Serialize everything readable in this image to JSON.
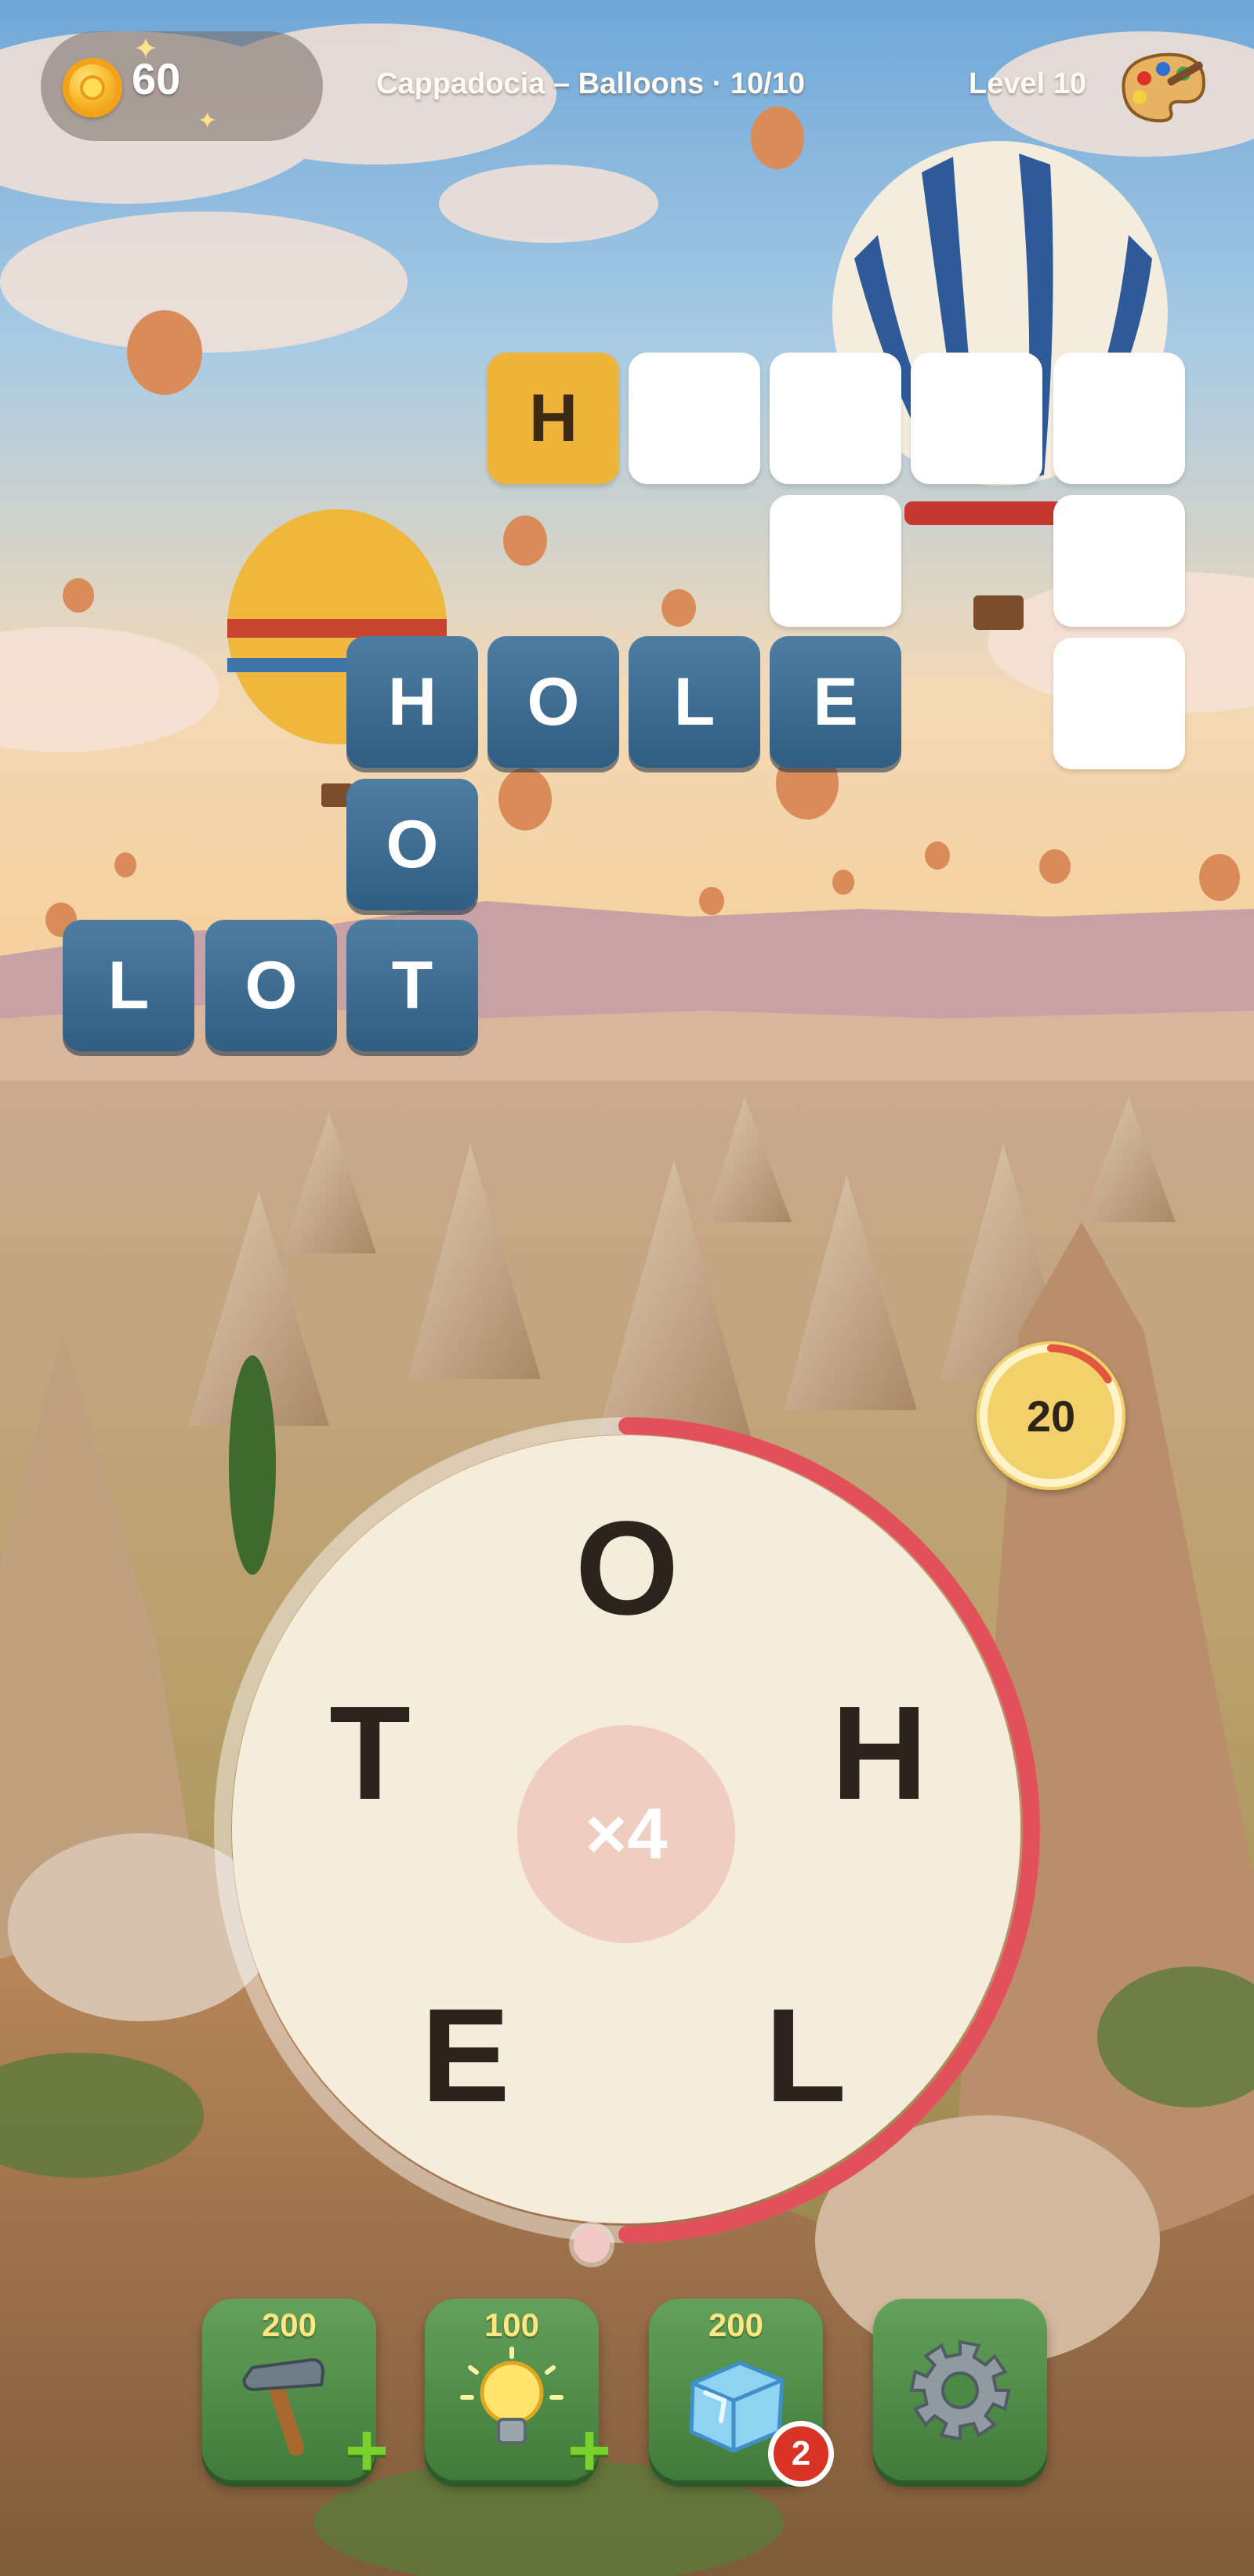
{
  "header": {
    "coins": "60",
    "level_name": "Cappadocia – Balloons · 10/10",
    "level_label": "Level 10",
    "palette_icon": "paint-palette-icon"
  },
  "crossword": {
    "hint_letter": "H",
    "words": [
      "HOLE",
      "HOT",
      "LOT"
    ],
    "tiles_hole": [
      "H",
      "O",
      "L",
      "E"
    ],
    "tile_hot_o": "O",
    "tiles_lot": [
      "L",
      "O",
      "T"
    ]
  },
  "timer": {
    "value": "20",
    "remaining_fraction": 0.84
  },
  "wheel": {
    "letters": {
      "top": "O",
      "right": "H",
      "bottom_right": "L",
      "bottom_left": "E",
      "left": "T"
    },
    "shuffle_label": "×4",
    "progress_fraction": 0.5
  },
  "boosters": [
    {
      "name": "hammer",
      "cost": "200",
      "icon": "hammer-icon"
    },
    {
      "name": "hint",
      "cost": "100",
      "icon": "lightbulb-icon"
    },
    {
      "name": "freeze",
      "cost": "200",
      "icon": "ice-cube-icon",
      "count": "2"
    },
    {
      "name": "settings",
      "icon": "gear-icon"
    }
  ],
  "colors": {
    "solved_tile": "#3c6b90",
    "hint_tile": "#efb53a",
    "ring_accent": "#e2505a",
    "booster_green": "#4f8d47"
  }
}
